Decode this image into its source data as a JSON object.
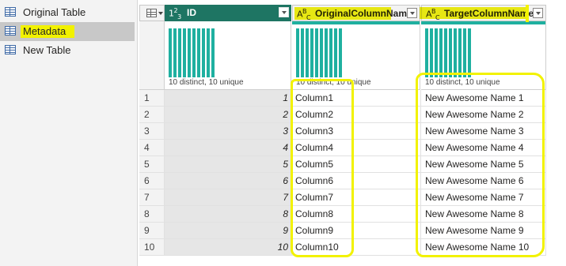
{
  "queries": [
    {
      "name": "Original Table",
      "selected": false
    },
    {
      "name": "Metadata",
      "selected": true
    },
    {
      "name": "New Table",
      "selected": false
    }
  ],
  "columns": [
    {
      "type_icon": "1²3",
      "name": "ID",
      "profile": "10 distinct, 10 unique"
    },
    {
      "type_icon": "ABC",
      "name": "OriginalColumnName",
      "profile": "10 distinct, 10 unique"
    },
    {
      "type_icon": "ABC",
      "name": "TargetColumnName",
      "profile": "10 distinct, 10 unique"
    }
  ],
  "rows": [
    {
      "num": "1",
      "id": "1",
      "orig": "Column1",
      "tgt": "New Awesome Name 1"
    },
    {
      "num": "2",
      "id": "2",
      "orig": "Column2",
      "tgt": "New Awesome Name 2"
    },
    {
      "num": "3",
      "id": "3",
      "orig": "Column3",
      "tgt": "New Awesome Name 3"
    },
    {
      "num": "4",
      "id": "4",
      "orig": "Column4",
      "tgt": "New Awesome Name 4"
    },
    {
      "num": "5",
      "id": "5",
      "orig": "Column5",
      "tgt": "New Awesome Name 5"
    },
    {
      "num": "6",
      "id": "6",
      "orig": "Column6",
      "tgt": "New Awesome Name 6"
    },
    {
      "num": "7",
      "id": "7",
      "orig": "Column7",
      "tgt": "New Awesome Name 7"
    },
    {
      "num": "8",
      "id": "8",
      "orig": "Column8",
      "tgt": "New Awesome Name 8"
    },
    {
      "num": "9",
      "id": "9",
      "orig": "Column9",
      "tgt": "New Awesome Name 9"
    },
    {
      "num": "10",
      "id": "10",
      "orig": "Column10",
      "tgt": "New Awesome Name 10"
    }
  ],
  "colors": {
    "selected_header": "#1e7563",
    "quality_bar": "#1fb0a0",
    "highlight": "#f2f200"
  }
}
